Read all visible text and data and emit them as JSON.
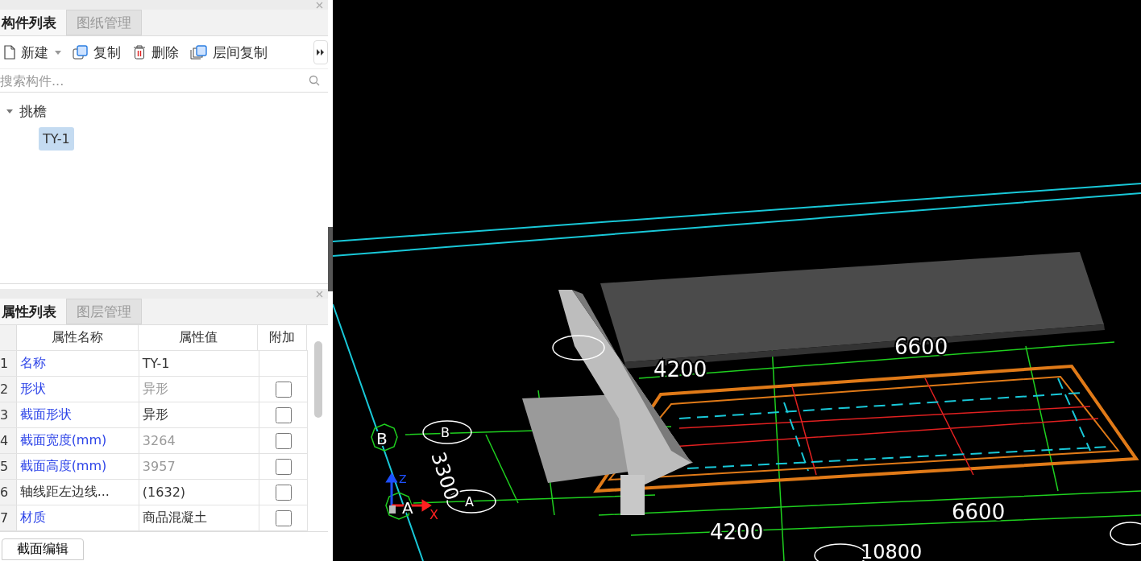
{
  "component_panel": {
    "tabs": [
      {
        "label": "构件列表",
        "selected": true
      },
      {
        "label": "图纸管理",
        "selected": false
      }
    ],
    "toolbar": [
      {
        "kind": "new",
        "label": "新建",
        "dropdown": true
      },
      {
        "kind": "copy",
        "label": "复制",
        "dropdown": false
      },
      {
        "kind": "delete",
        "label": "删除",
        "dropdown": false
      },
      {
        "kind": "floor-copy",
        "label": "层间复制",
        "dropdown": false
      }
    ],
    "search": {
      "placeholder": "搜索构件..."
    },
    "tree": [
      {
        "label": "挑檐",
        "expanded": true,
        "selected": false,
        "children": [
          {
            "label": "TY-1",
            "selected": true
          }
        ]
      }
    ]
  },
  "property_panel": {
    "tabs": [
      {
        "label": "属性列表",
        "selected": true
      },
      {
        "label": "图层管理",
        "selected": false
      }
    ],
    "columns": [
      "属性名称",
      "属性值",
      "附加"
    ],
    "rows": [
      {
        "index": "1",
        "name": "名称",
        "public": true,
        "value": "TY-1",
        "greyed": false,
        "has_extra": false
      },
      {
        "index": "2",
        "name": "形状",
        "public": true,
        "value": "异形",
        "greyed": true,
        "has_extra": true,
        "checked": false
      },
      {
        "index": "3",
        "name": "截面形状",
        "public": true,
        "value": "异形",
        "greyed": false,
        "has_extra": true,
        "checked": false
      },
      {
        "index": "4",
        "name": "截面宽度(mm)",
        "public": true,
        "value": "3264",
        "greyed": true,
        "has_extra": true,
        "checked": false
      },
      {
        "index": "5",
        "name": "截面高度(mm)",
        "public": true,
        "value": "3957",
        "greyed": true,
        "has_extra": true,
        "checked": false
      },
      {
        "index": "6",
        "name": "轴线距左边线...",
        "public": false,
        "value": "(1632)",
        "greyed": false,
        "has_extra": true,
        "checked": false
      },
      {
        "index": "7",
        "name": "材质",
        "public": true,
        "value": "商品混凝土",
        "greyed": false,
        "has_extra": true,
        "checked": false
      }
    ],
    "bottom_button": "截面编辑"
  },
  "viewport": {
    "labels": [
      "4200",
      "6600",
      "4200",
      "6600",
      "10800",
      "3300",
      "B",
      "B",
      "A",
      "A",
      "Z",
      "X"
    ]
  }
}
